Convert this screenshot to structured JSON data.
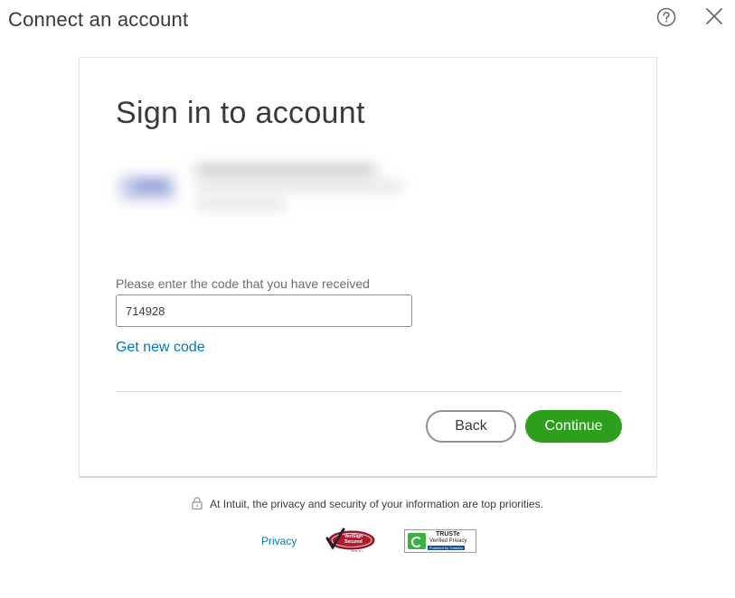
{
  "header": {
    "title": "Connect an account"
  },
  "card": {
    "title": "Sign in to account",
    "code_label": "Please enter the code that you have received",
    "code_value": "714928",
    "new_code_link": "Get new code",
    "back_label": "Back",
    "continue_label": "Continue"
  },
  "footer": {
    "privacy_note": "At Intuit, the privacy and security of your information are top priorities.",
    "privacy_link": "Privacy",
    "verisign_badge": {
      "line1": "VeriSign",
      "line2": "Secured",
      "verify": "VERIFY"
    },
    "truste_badge": {
      "name": "TRUSTe",
      "subtitle": "Verified Privacy",
      "powered": "Powered by TrustArc"
    }
  },
  "colors": {
    "accent_green": "#2ca01c",
    "link_blue": "#0077c5",
    "text_dark": "#393a3d"
  },
  "icons": {
    "help": "help-circle-icon",
    "close": "close-icon",
    "lock": "lock-icon"
  }
}
